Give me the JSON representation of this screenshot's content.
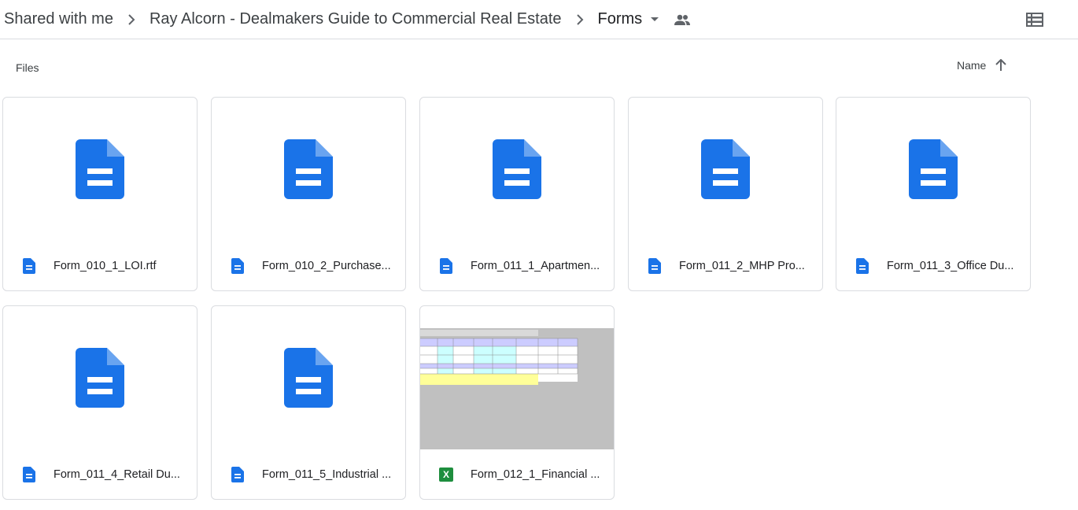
{
  "breadcrumb": {
    "items": [
      "Shared with me",
      "Ray Alcorn - Dealmakers Guide to Commercial Real Estate",
      "Forms"
    ]
  },
  "files_section": {
    "heading": "Files",
    "sort_label": "Name"
  },
  "files": [
    {
      "name": "Form_010_1_LOI.rtf",
      "type": "document"
    },
    {
      "name": "Form_010_2_Purchase...",
      "type": "document"
    },
    {
      "name": "Form_011_1_Apartmen...",
      "type": "document"
    },
    {
      "name": "Form_011_2_MHP Pro...",
      "type": "document"
    },
    {
      "name": "Form_011_3_Office Du...",
      "type": "document"
    },
    {
      "name": "Form_011_4_Retail Du...",
      "type": "document"
    },
    {
      "name": "Form_011_5_Industrial ...",
      "type": "document"
    },
    {
      "name": "Form_012_1_Financial ...",
      "type": "spreadsheet"
    }
  ],
  "spreadsheet_badge": "X",
  "colors": {
    "doc_blue": "#1a73e8",
    "sheet_green": "#1e8e3e",
    "border": "#dadce0"
  },
  "icons": [
    "chevron-right-icon",
    "dropdown-arrow-icon",
    "shared-people-icon",
    "list-view-icon",
    "sort-up-arrow-icon",
    "document-icon",
    "spreadsheet-icon"
  ]
}
